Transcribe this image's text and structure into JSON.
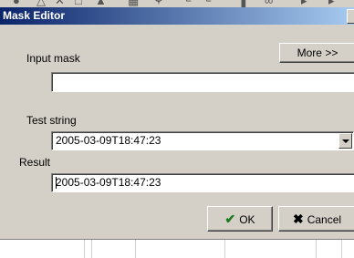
{
  "dialog": {
    "title": "Mask Editor"
  },
  "fields": {
    "input_mask_label": "Input mask",
    "input_mask_value": "",
    "test_string_label": "Test string",
    "test_string_value": "2005-03-09T18:47:23",
    "result_label": "Result",
    "result_value": "2005-03-09T18:47:23"
  },
  "buttons": {
    "more_label": "More >>",
    "ok_label": "OK",
    "cancel_label": "Cancel"
  },
  "icons": {
    "ok_icon": "check-icon",
    "cancel_icon": "cross-icon",
    "dropdown_icon": "chevron-down-icon"
  }
}
